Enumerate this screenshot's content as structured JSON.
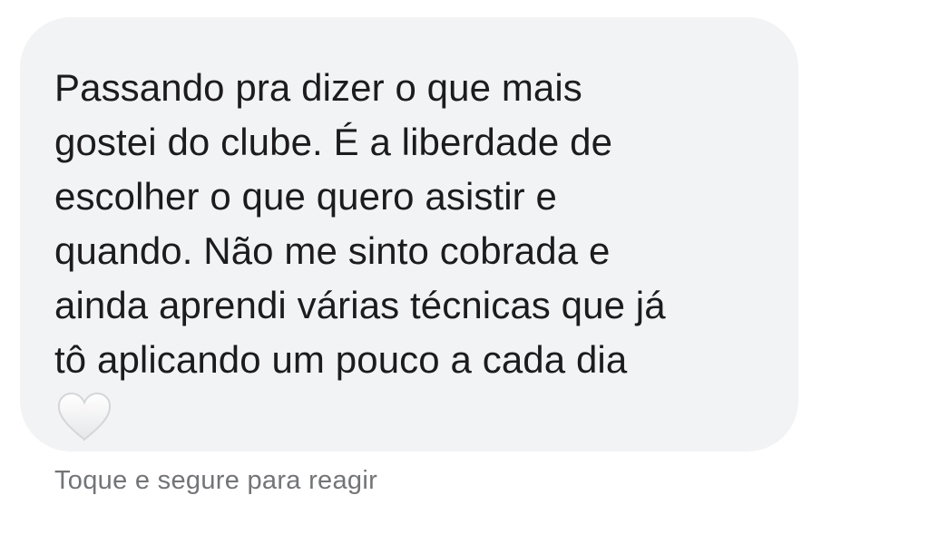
{
  "message": {
    "lines": [
      "Passando pra dizer o que mais",
      "gostei do clube. É a liberdade de",
      "escolher o que quero asistir e",
      "quando. Não me sinto cobrada e",
      "ainda aprendi várias técnicas que já",
      "tô aplicando um pouco a cada dia"
    ],
    "emoji": "white-heart-icon"
  },
  "reaction_hint": "Toque e segure para reagir",
  "colors": {
    "background": "#ffffff",
    "bubble": "#f2f3f5",
    "message_text": "#1c1c1e",
    "hint_text": "#727478",
    "heart_fill": "#f4f4f4",
    "heart_stroke": "#d5d6d8"
  }
}
